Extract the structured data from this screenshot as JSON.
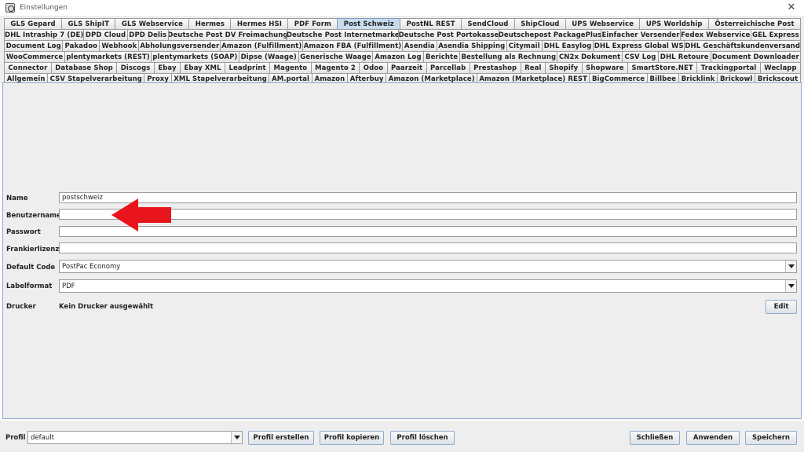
{
  "window": {
    "title": "Einstellungen",
    "close": "✕"
  },
  "tabs": {
    "rows": [
      [
        "GLS Gepard",
        "GLS ShipIT",
        "GLS Webservice",
        "Hermes",
        "Hermes HSI",
        "PDF Form",
        "Post Schweiz",
        "PostNL REST",
        "SendCloud",
        "ShipCloud",
        "UPS Webservice",
        "UPS Worldship",
        "Österreichische Post"
      ],
      [
        "DHL Intraship 7 (DE)",
        "DPD Cloud",
        "DPD Delis",
        "Deutsche Post DV Freimachung",
        "Deutsche Post Internetmarke",
        "Deutsche Post Portokasse",
        "Deutschepost PackagePlus",
        "Einfacher Versender",
        "Fedex Webservice",
        "GEL Express"
      ],
      [
        "Document Log",
        "Pakadoo",
        "Webhook",
        "Abholungsversender",
        "Amazon (Fulfillment)",
        "Amazon FBA (Fulfillment)",
        "Asendia",
        "Asendia Shipping",
        "Citymail",
        "DHL Easylog",
        "DHL Express Global WS",
        "DHL Geschäftskundenversand"
      ],
      [
        "WooCommerce",
        "plentymarkets (REST)",
        "plentymarkets (SOAP)",
        "Dipse (Waage)",
        "Generische Waage",
        "Amazon Log",
        "Berichte",
        "Bestellung als Rechnung",
        "CN2x Dokument",
        "CSV Log",
        "DHL Retoure",
        "Document Downloader"
      ],
      [
        "Connector",
        "Database Shop",
        "Discogs",
        "Ebay",
        "Ebay XML",
        "Leadprint",
        "Magento",
        "Magento 2",
        "Odoo",
        "Paarzeit",
        "Parcellab",
        "Prestashop",
        "Real",
        "Shopify",
        "Shopware",
        "SmartStore.NET",
        "Trackingportal",
        "Weclapp"
      ],
      [
        "Allgemein",
        "CSV Stapelverarbeitung",
        "Proxy",
        "XML Stapelverarbeitung",
        "AM.portal",
        "Amazon",
        "Afterbuy",
        "Amazon (Marketplace)",
        "Amazon (Marketplace) REST",
        "BigCommerce",
        "Billbee",
        "Bricklink",
        "Brickowl",
        "Brickscout"
      ]
    ],
    "active": "Post Schweiz"
  },
  "form": {
    "name_label": "Name",
    "name_value": "postschweiz",
    "user_label": "Benutzername",
    "user_value": "",
    "password_label": "Passwort",
    "password_value": "",
    "license_label": "Frankierlizenz",
    "license_value": "",
    "default_code_label": "Default Code",
    "default_code_value": "PostPac Economy",
    "labelformat_label": "Labelformat",
    "labelformat_value": "PDF",
    "printer_label": "Drucker",
    "printer_value": "Kein Drucker ausgewählt",
    "edit_button": "Edit"
  },
  "footer": {
    "profile_label": "Profil",
    "profile_value": "default",
    "create_button": "Profil erstellen",
    "copy_button": "Profil kopieren",
    "delete_button": "Profil löschen",
    "close_button": "Schließen",
    "apply_button": "Anwenden",
    "save_button": "Speichern"
  },
  "colors": {
    "active_tab": "#c9dcef",
    "arrow": "#e8161c",
    "panel_border": "#8faacc"
  }
}
